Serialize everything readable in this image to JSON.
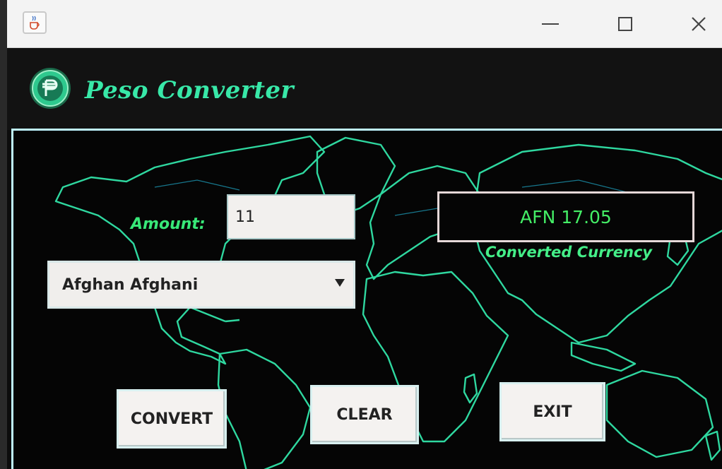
{
  "window": {
    "icon": "java-cup-icon",
    "controls": {
      "minimize": "minimize-icon",
      "maximize": "maximize-icon",
      "close": "close-icon"
    }
  },
  "header": {
    "title": "Peso Converter",
    "logo": "peso-coin-icon"
  },
  "form": {
    "amount_label": "Amount:",
    "amount_value": "11",
    "currency_selected": "Afghan Afghani",
    "result_value": "AFN 17.05",
    "result_label": "Converted Currency"
  },
  "buttons": {
    "convert": "CONVERT",
    "clear": "CLEAR",
    "exit": "EXIT"
  },
  "colors": {
    "accent": "#38e8a8",
    "map_outline": "#2fd8a0",
    "result_text": "#44ee66",
    "background": "#050505"
  }
}
